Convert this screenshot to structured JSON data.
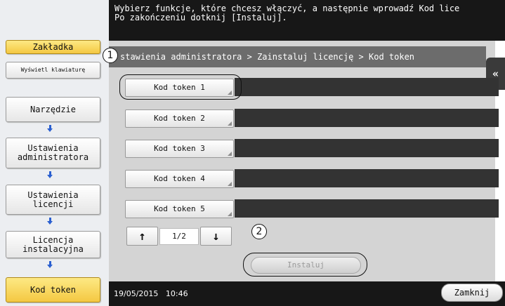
{
  "message": {
    "line1": "Wybierz funkcje, które chcesz włączyć, a następnie wprowadź Kod lice",
    "line2": "Po zakończeniu dotknij [Instaluj]."
  },
  "left_nav": {
    "bookmark": "Zakładka",
    "keyboard": "Wyświetl klawiaturę",
    "items": [
      "Narzędzie",
      "Ustawienia administratora",
      "Ustawienia licencji",
      "Licencja instalacyjna",
      "Kod token"
    ]
  },
  "breadcrumb": "stawienia administratora > Zainstaluj licencję > Kod token",
  "collapse_icon": "«",
  "tokens": [
    {
      "label": "Kod token 1",
      "value": ""
    },
    {
      "label": "Kod token 2",
      "value": ""
    },
    {
      "label": "Kod token 3",
      "value": ""
    },
    {
      "label": "Kod token 4",
      "value": ""
    },
    {
      "label": "Kod token 5",
      "value": ""
    }
  ],
  "pager": {
    "text": "1/2",
    "up_icon": "↑",
    "down_icon": "↓"
  },
  "install_label": "Instaluj",
  "callouts": {
    "one": "1",
    "two": "2"
  },
  "status": {
    "date": "19/05/2015",
    "time": "10:46"
  },
  "close_label": "Zamknij"
}
